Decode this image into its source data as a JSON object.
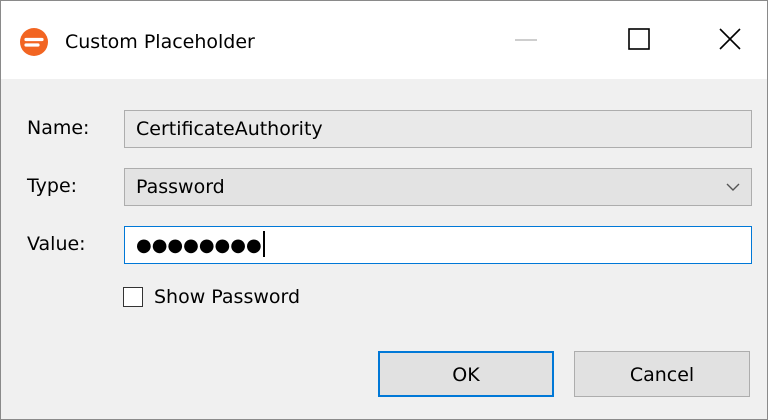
{
  "window": {
    "title": "Custom Placeholder",
    "app_icon": "app-logo-icon",
    "controls": [
      "minimize-icon",
      "maximize-icon",
      "close-icon"
    ]
  },
  "form": {
    "name_label": "Name:",
    "name_value": "CertificateAuthority",
    "type_label": "Type:",
    "type_value": "Password",
    "value_label": "Value:",
    "value_masked": "●●●●●●●●",
    "show_password_label": "Show Password",
    "show_password_checked": false
  },
  "buttons": {
    "ok": "OK",
    "cancel": "Cancel"
  },
  "colors": {
    "accent": "#0078d7",
    "app_icon": "#f26522"
  }
}
